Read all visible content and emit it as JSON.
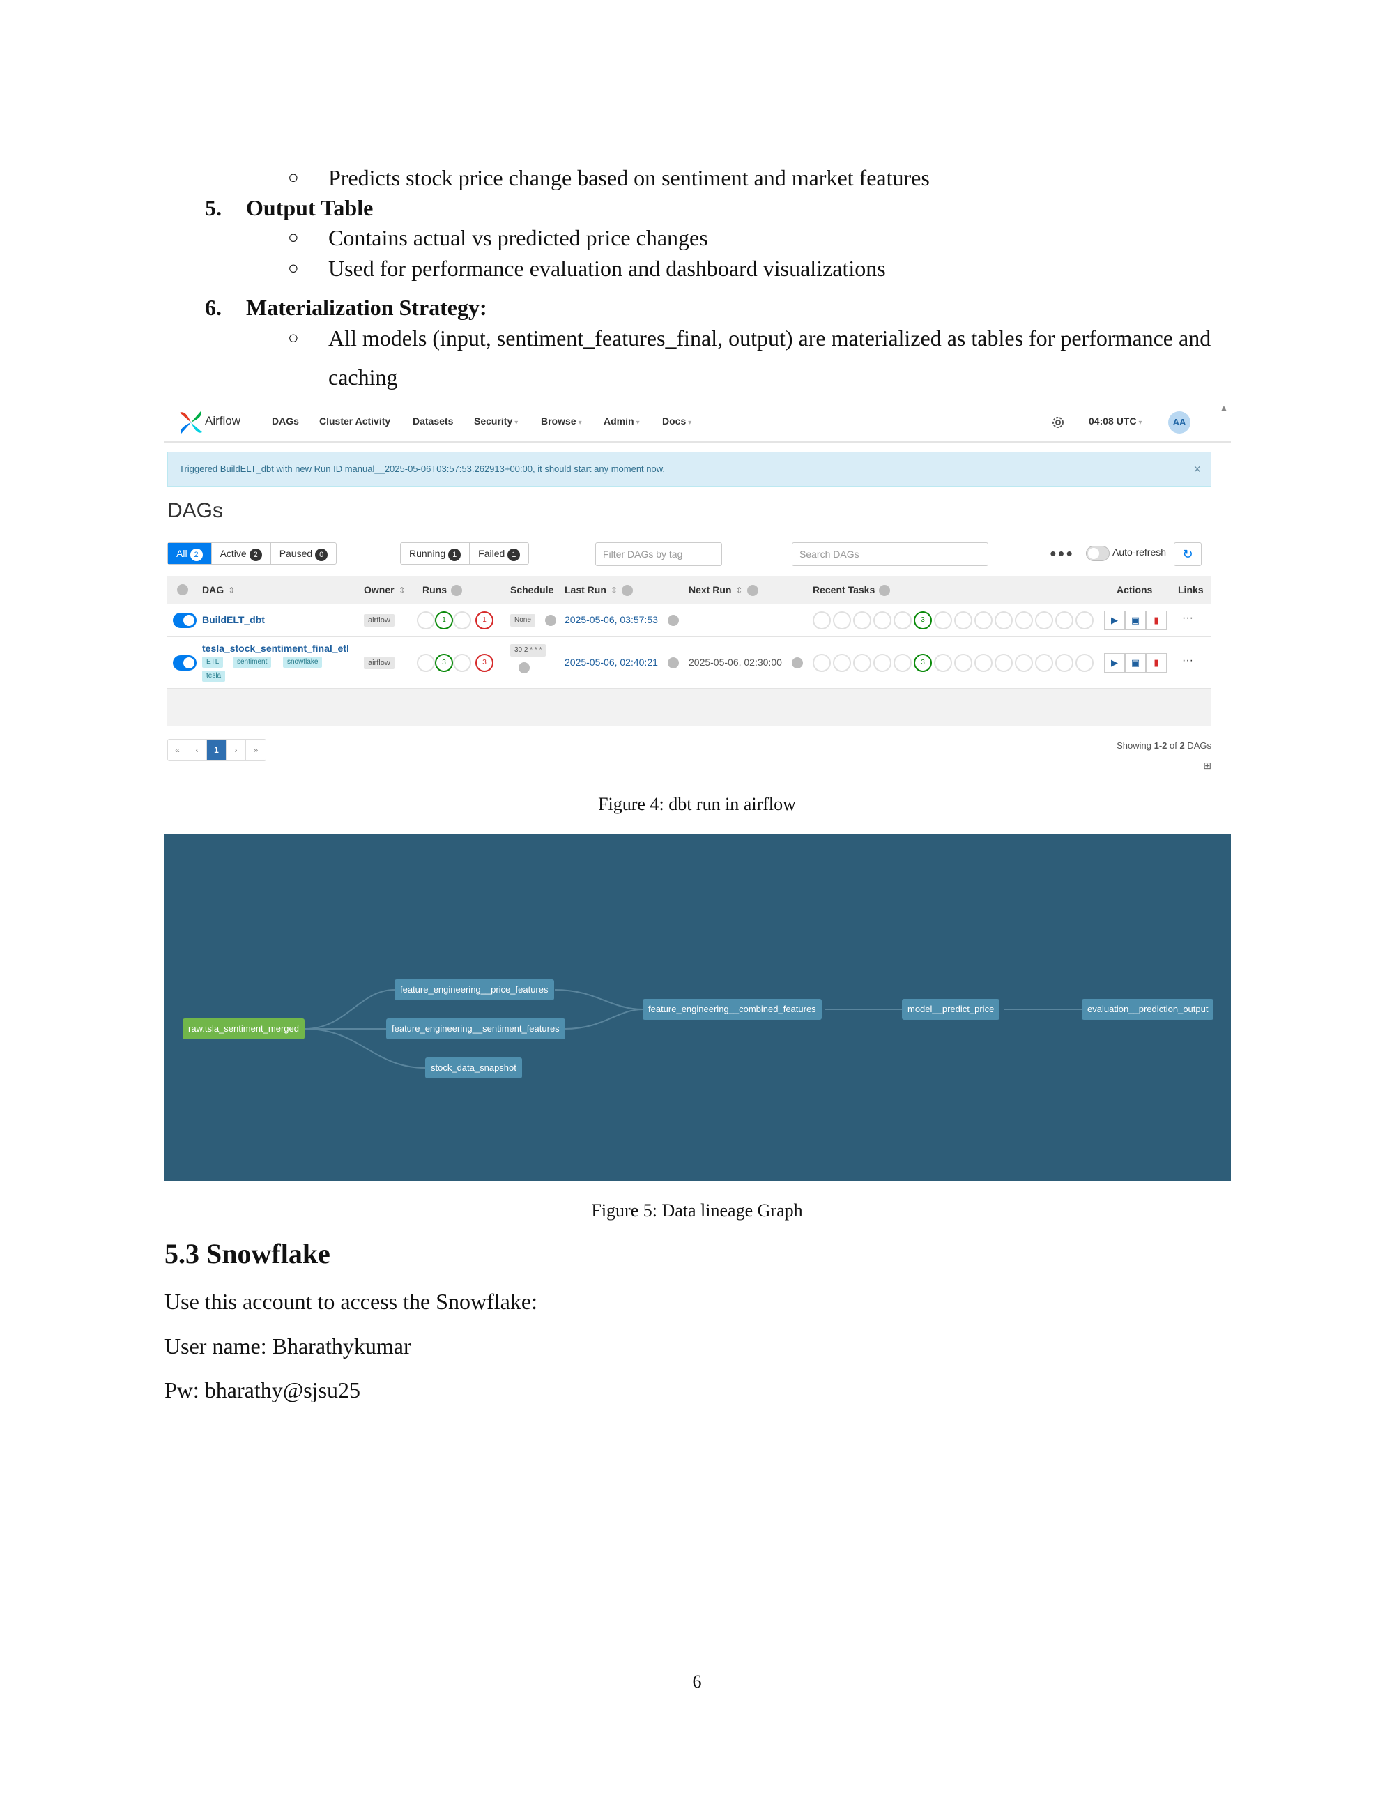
{
  "doc": {
    "bullet_char": "○",
    "line1": "Predicts stock price change based on sentiment and market features",
    "item5_num": "5.",
    "item5_title": "Output Table",
    "item5_b1": "Contains actual vs predicted price changes",
    "item5_b2": "Used for performance evaluation and dashboard visualizations",
    "item6_num": "6.",
    "item6_title": "Materialization Strategy:",
    "item6_b1_line1": "All models (input, sentiment_features_final, output) are materialized as tables for performance and",
    "item6_b1_line2": "caching",
    "figure4_caption": "Figure 4: dbt run in airflow",
    "figure5_caption": "Figure 5: Data lineage Graph",
    "section_heading": "5.3 Snowflake",
    "para1": "Use this account to access the Snowflake:",
    "para2": "User name: Bharathykumar",
    "para3": "Pw: bharathy@sjsu25",
    "page_number": "6"
  },
  "airflow": {
    "logo_text": "Airflow",
    "menu": [
      "DAGs",
      "Cluster Activity",
      "Datasets",
      "Security",
      "Browse",
      "Admin",
      "Docs"
    ],
    "time": "04:08 UTC",
    "avatar": "AA",
    "banner": "Triggered BuildELT_dbt with new Run ID manual__2025-05-06T03:57:53.262913+00:00, it should start any moment now.",
    "banner_close": "×",
    "title": "DAGs",
    "filters": {
      "all_label": "All",
      "all_count": "2",
      "active_label": "Active",
      "active_count": "2",
      "paused_label": "Paused",
      "paused_count": "0",
      "running_label": "Running",
      "running_count": "1",
      "failed_label": "Failed",
      "failed_count": "1"
    },
    "tag_filter_placeholder": "Filter DAGs by tag",
    "search_placeholder": "Search DAGs",
    "auto_refresh_label": "Auto-refresh",
    "columns": {
      "dag": "DAG",
      "owner": "Owner",
      "runs": "Runs",
      "schedule": "Schedule",
      "last_run": "Last Run",
      "next_run": "Next Run",
      "recent_tasks": "Recent Tasks",
      "actions": "Actions",
      "links": "Links"
    },
    "rows": [
      {
        "dag_id": "BuildELT_dbt",
        "tags": [],
        "owner": "airflow",
        "runs_success": "1",
        "runs_failed": "1",
        "schedule": "None",
        "last_run": "2025-05-06, 03:57:53",
        "next_run": "",
        "recent_success": "3"
      },
      {
        "dag_id": "tesla_stock_sentiment_final_etl",
        "tags": [
          "ETL",
          "sentiment",
          "snowflake",
          "tesla"
        ],
        "owner": "airflow",
        "runs_success": "3",
        "runs_failed": "3",
        "schedule": "30 2 * * *",
        "last_run": "2025-05-06, 02:40:21",
        "next_run": "2025-05-06, 02:30:00",
        "recent_success": "3"
      }
    ],
    "pagination": {
      "first": "«",
      "prev": "‹",
      "current": "1",
      "next": "›",
      "last": "»"
    },
    "showing_prefix": "Showing ",
    "showing_range": "1-2",
    "showing_mid": " of ",
    "showing_total": "2",
    "showing_suffix": " DAGs"
  },
  "lineage": {
    "background_color": "#2e5d78",
    "node_color": "#4f8fae",
    "source_color": "#71b64a",
    "nodes": {
      "source": "raw.tsla_sentiment_merged",
      "price_features": "feature_engineering__price_features",
      "sentiment_features": "feature_engineering__sentiment_features",
      "stock_snapshot": "stock_data_snapshot",
      "combined": "feature_engineering__combined_features",
      "predict": "model__predict_price",
      "evaluation": "evaluation__prediction_output"
    }
  }
}
